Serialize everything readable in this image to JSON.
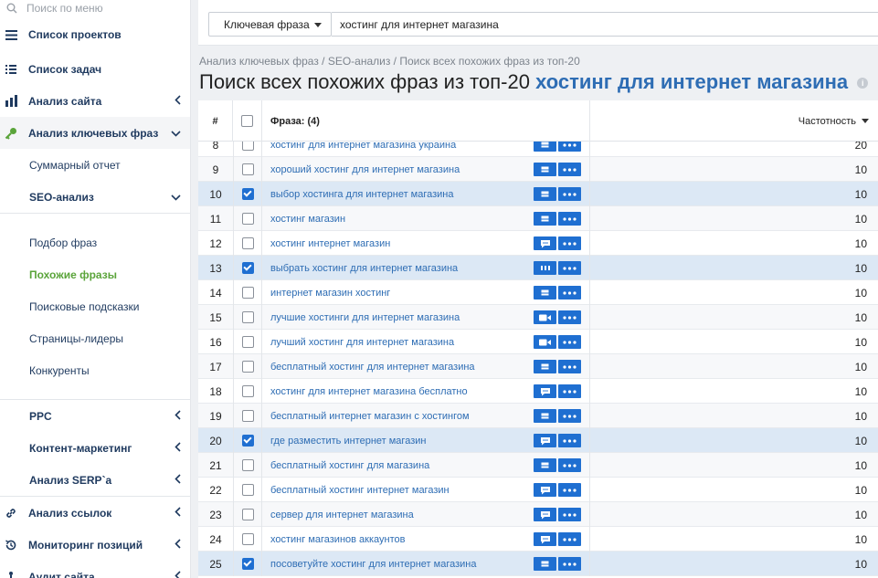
{
  "sidebar": {
    "search_placeholder": "Поиск по меню",
    "items": [
      {
        "label": "Список проектов",
        "icon": "menu-icon"
      },
      {
        "label": "Список задач",
        "icon": "list-icon"
      },
      {
        "label": "Анализ сайта",
        "icon": "site-analysis-icon"
      },
      {
        "label": "Анализ ключевых фраз",
        "icon": "key-icon"
      }
    ],
    "sub_items": [
      {
        "label": "Суммарный отчет"
      },
      {
        "label": "SEO-анализ"
      },
      {
        "label": "Подбор фраз"
      },
      {
        "label": "Похожие фразы"
      },
      {
        "label": "Поисковые подсказки"
      },
      {
        "label": "Страницы-лидеры"
      },
      {
        "label": "Конкуренты"
      },
      {
        "label": "PPC"
      },
      {
        "label": "Контент-маркетинг"
      },
      {
        "label": "Анализ SERP`a"
      }
    ],
    "bottom_items": [
      {
        "label": "Анализ ссылок",
        "icon": "link-icon"
      },
      {
        "label": "Мониторинг позиций",
        "icon": "history-icon"
      },
      {
        "label": "Аудит сайта",
        "icon": "audit-icon"
      }
    ]
  },
  "topbar": {
    "select_label": "Ключевая фраза",
    "search_value": "хостинг для интернет магазина"
  },
  "breadcrumb": "Анализ ключевых фраз / SEO-анализ / Поиск всех похожих фраз из топ-20",
  "title": {
    "prefix": "Поиск всех похожих фраз из топ-20",
    "keyword": "хостинг для интернет магазина"
  },
  "table": {
    "col_num": "#",
    "col_phrase": "Фраза: (4)",
    "col_freq": "Частотность",
    "rows": [
      {
        "n": "8",
        "phrase": "хостинг для интернет магазина украина",
        "freq": "20",
        "checked": false,
        "icon": "table"
      },
      {
        "n": "9",
        "phrase": "хороший хостинг для интернет магазина",
        "freq": "10",
        "checked": false,
        "icon": "table"
      },
      {
        "n": "10",
        "phrase": "выбор хостинга для интернет магазина",
        "freq": "10",
        "checked": true,
        "icon": "table"
      },
      {
        "n": "11",
        "phrase": "хостинг магазин",
        "freq": "10",
        "checked": false,
        "icon": "table"
      },
      {
        "n": "12",
        "phrase": "хостинг интернет магазин",
        "freq": "10",
        "checked": false,
        "icon": "chat"
      },
      {
        "n": "13",
        "phrase": "выбрать хостинг для интернет магазина",
        "freq": "10",
        "checked": true,
        "icon": "bars"
      },
      {
        "n": "14",
        "phrase": "интернет магазин хостинг",
        "freq": "10",
        "checked": false,
        "icon": "table"
      },
      {
        "n": "15",
        "phrase": "лучшие хостинги для интернет магазина",
        "freq": "10",
        "checked": false,
        "icon": "video"
      },
      {
        "n": "16",
        "phrase": "лучший хостинг для интернет магазина",
        "freq": "10",
        "checked": false,
        "icon": "video"
      },
      {
        "n": "17",
        "phrase": "бесплатный хостинг для интернет магазина",
        "freq": "10",
        "checked": false,
        "icon": "table"
      },
      {
        "n": "18",
        "phrase": "хостинг для интернет магазина бесплатно",
        "freq": "10",
        "checked": false,
        "icon": "chat"
      },
      {
        "n": "19",
        "phrase": "бесплатный интернет магазин с хостингом",
        "freq": "10",
        "checked": false,
        "icon": "table"
      },
      {
        "n": "20",
        "phrase": "где разместить интернет магазин",
        "freq": "10",
        "checked": true,
        "icon": "chat"
      },
      {
        "n": "21",
        "phrase": "бесплатный хостинг для магазина",
        "freq": "10",
        "checked": false,
        "icon": "table"
      },
      {
        "n": "22",
        "phrase": "бесплатный хостинг интернет магазин",
        "freq": "10",
        "checked": false,
        "icon": "chat"
      },
      {
        "n": "23",
        "phrase": "сервер для интернет магазина",
        "freq": "10",
        "checked": false,
        "icon": "chat"
      },
      {
        "n": "24",
        "phrase": "хостинг магазинов аккаунтов",
        "freq": "10",
        "checked": false,
        "icon": "chat"
      },
      {
        "n": "25",
        "phrase": "посоветуйте хостинг для интернет магазина",
        "freq": "10",
        "checked": true,
        "icon": "table"
      }
    ]
  },
  "colors": {
    "accent": "#1f6fd1",
    "link": "#2e6db4",
    "active_green": "#5aa43a",
    "checked_row": "#dce8f5"
  }
}
